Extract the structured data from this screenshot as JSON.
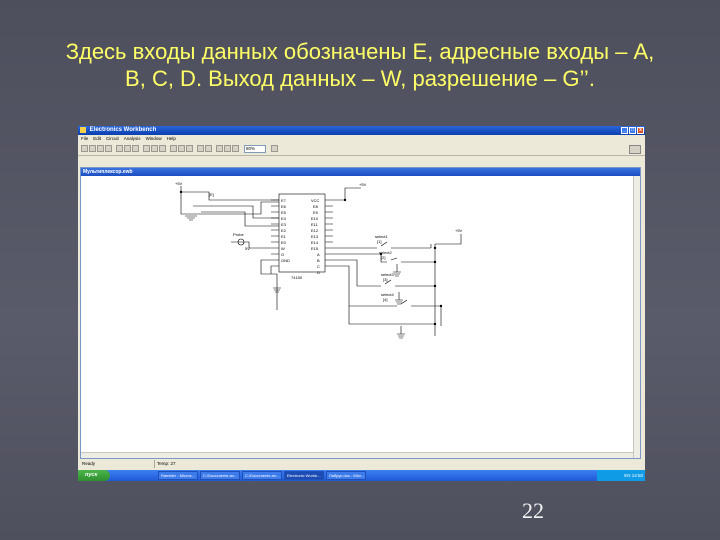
{
  "slide": {
    "title_line1": "Здесь входы данных обозначены E, адресные входы – A,",
    "title_line2": "B, C, D. Выход данных – W, разрешение – G’’.",
    "page_number": "22"
  },
  "window": {
    "title": "Electronics Workbench",
    "menu": [
      "File",
      "Edit",
      "Circuit",
      "Analysis",
      "Window",
      "Help"
    ],
    "zoom": "80%",
    "min": "_",
    "max": "□",
    "close": "x"
  },
  "document": {
    "title": "Мультиплексор.ewb",
    "chip": {
      "part": "74150",
      "left_pins": [
        "E7",
        "E6",
        "E5",
        "E4",
        "E3",
        "E2",
        "E1",
        "E0",
        "W",
        "G",
        "GND"
      ],
      "right_pins": [
        "VCC",
        "E8",
        "E9",
        "E10",
        "E11",
        "E12",
        "E13",
        "E14",
        "A",
        "B",
        "C"
      ],
      "right_pins_extra": [
        "E15",
        "D"
      ]
    },
    "labels": {
      "v1": "+5V",
      "v2": "+5V",
      "v3": "+5V",
      "probe": "Probe",
      "probe_v": "5V",
      "switch_a": "select1",
      "switch_b": "select2",
      "switch_c": "select3",
      "switch_d": "select4",
      "key_a": "[1]",
      "key_b": "[2]",
      "key_c": "[3]",
      "key_d": "[4]",
      "key_e": "[E]"
    }
  },
  "status": {
    "left": "Ready",
    "temp": "Temp: 27"
  },
  "taskbar": {
    "start": "пуск",
    "tasks": [
      "Rambler - Micros...",
      "C:\\Documents an...",
      "C:\\Documents an...",
      "Electronic Workb...",
      "Лабрус.doc - Micr..."
    ],
    "clock": "EN 14:50"
  }
}
